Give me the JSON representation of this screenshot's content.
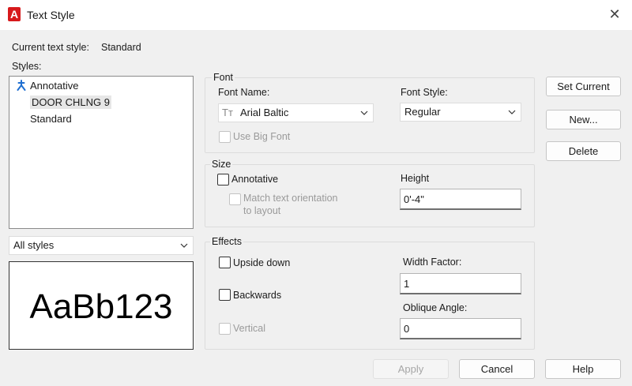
{
  "window": {
    "title": "Text Style",
    "logo_letter": "A",
    "close_glyph": "✕"
  },
  "current_style": {
    "label": "Current text style:",
    "value": "Standard"
  },
  "styles": {
    "label": "Styles:",
    "items": [
      {
        "label": "Annotative",
        "icon": "annotative-icon"
      },
      {
        "label": "DOOR CHLNG 9",
        "selected": true
      },
      {
        "label": "Standard"
      }
    ],
    "filter": {
      "selected": "All styles"
    }
  },
  "preview": {
    "sample_text": "AaBb123"
  },
  "font": {
    "group_label": "Font",
    "name_label": "Font Name:",
    "name_value": "Arial Baltic",
    "style_label": "Font Style:",
    "style_value": "Regular",
    "use_big_font_label": "Use Big Font",
    "use_big_font_checked": false
  },
  "size": {
    "group_label": "Size",
    "annotative_label": "Annotative",
    "annotative_checked": false,
    "match_orientation_label_1": "Match text orientation",
    "match_orientation_label_2": "to layout",
    "height_label": "Height",
    "height_value": "0'-4\""
  },
  "effects": {
    "group_label": "Effects",
    "upside_down_label": "Upside down",
    "backwards_label": "Backwards",
    "vertical_label": "Vertical",
    "width_factor_label": "Width Factor:",
    "width_factor_value": "1",
    "oblique_angle_label": "Oblique Angle:",
    "oblique_angle_value": "0"
  },
  "buttons": {
    "set_current": "Set Current",
    "new": "New...",
    "delete": "Delete",
    "apply": "Apply",
    "cancel": "Cancel",
    "help": "Help"
  },
  "colors": {
    "logo_red": "#d7191c",
    "annotative_blue": "#1f6fd1"
  }
}
